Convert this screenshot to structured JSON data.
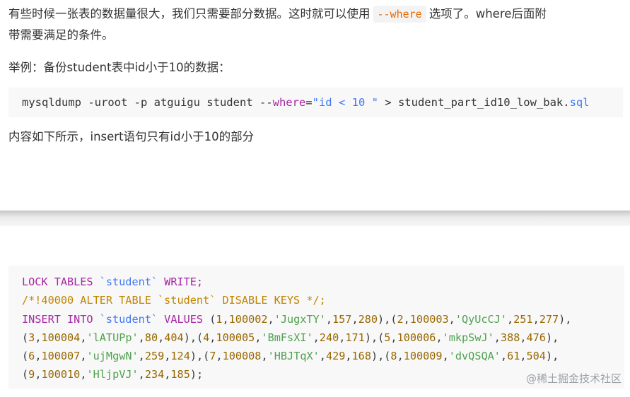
{
  "doc": {
    "p1_line1_a": "有些时候一张表的数据量很大，我们只需要部分数据。这时就可以使用",
    "inline_code": "--where",
    "p1_line1_b": "选项了。where后面附",
    "p1_line2": "带需要满足的条件。",
    "example_label": "举例：备份student表中id小于10的数据：",
    "cmd": {
      "part1": "mysqldump -uroot -p atguigu student --",
      "kw_where": "where",
      "eq": "=",
      "str_open": "\"id < 10 \"",
      "part2": " > student_part_id10_low_bak.",
      "ext": "sql"
    },
    "after_cmd": "内容如下所示，insert语句只有id小于10的部分"
  },
  "sql": {
    "line1_a": "LOCK TABLES ",
    "line1_tbl": "`student`",
    "line1_b": " WRITE;",
    "line2": "/*!40000 ALTER TABLE `student` DISABLE KEYS */;",
    "line3_a": "INSERT INTO ",
    "line3_tbl": "`student`",
    "line3_b": " VALUES ",
    "rows_line3": "(1,100002,'JugxTY',157,280),(2,100003,'QyUcCJ',251,277),",
    "rows_line4": "(3,100004,'lATUPp',80,404),(4,100005,'BmFsXI',240,171),(5,100006,'mkpSwJ',388,476),",
    "rows_line5": "(6,100007,'ujMgwN',259,124),(7,100008,'HBJTqX',429,168),(8,100009,'dvQSQA',61,504),",
    "rows_line6": "(9,100010,'HljpVJ',234,185);"
  },
  "watermark": "@稀土掘金技术社区"
}
